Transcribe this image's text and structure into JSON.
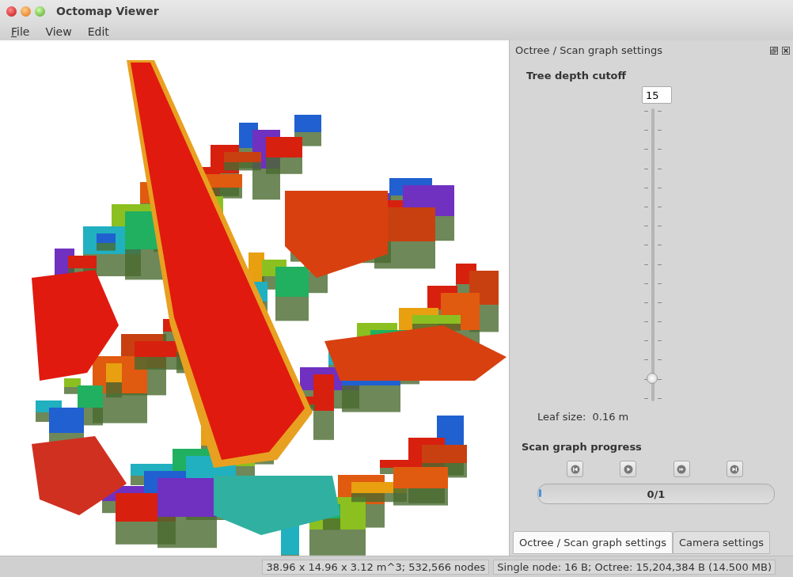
{
  "window": {
    "title": "Octomap Viewer"
  },
  "menu": [
    {
      "label": "File",
      "mnemonic": true
    },
    {
      "label": "View",
      "mnemonic": false
    },
    {
      "label": "Edit",
      "mnemonic": false
    }
  ],
  "dock": {
    "title": "Octree / Scan graph settings",
    "depth": {
      "label": "Tree depth cutoff",
      "value": "15",
      "level": 0.08
    },
    "leaf_size": "Leaf size:  0.16 m",
    "progress": {
      "label": "Scan graph progress",
      "text": "0/1",
      "level": 0
    }
  },
  "tabs": [
    {
      "label": "Octree / Scan graph settings",
      "selected": true
    },
    {
      "label": "Camera settings",
      "selected": false
    }
  ],
  "status_bar": [
    "38.96 x 14.96 x 3.12 m^3; 532,566 nodes",
    "Single node: 16 B; Octree: 15,204,384 B (14.500 MB)"
  ]
}
